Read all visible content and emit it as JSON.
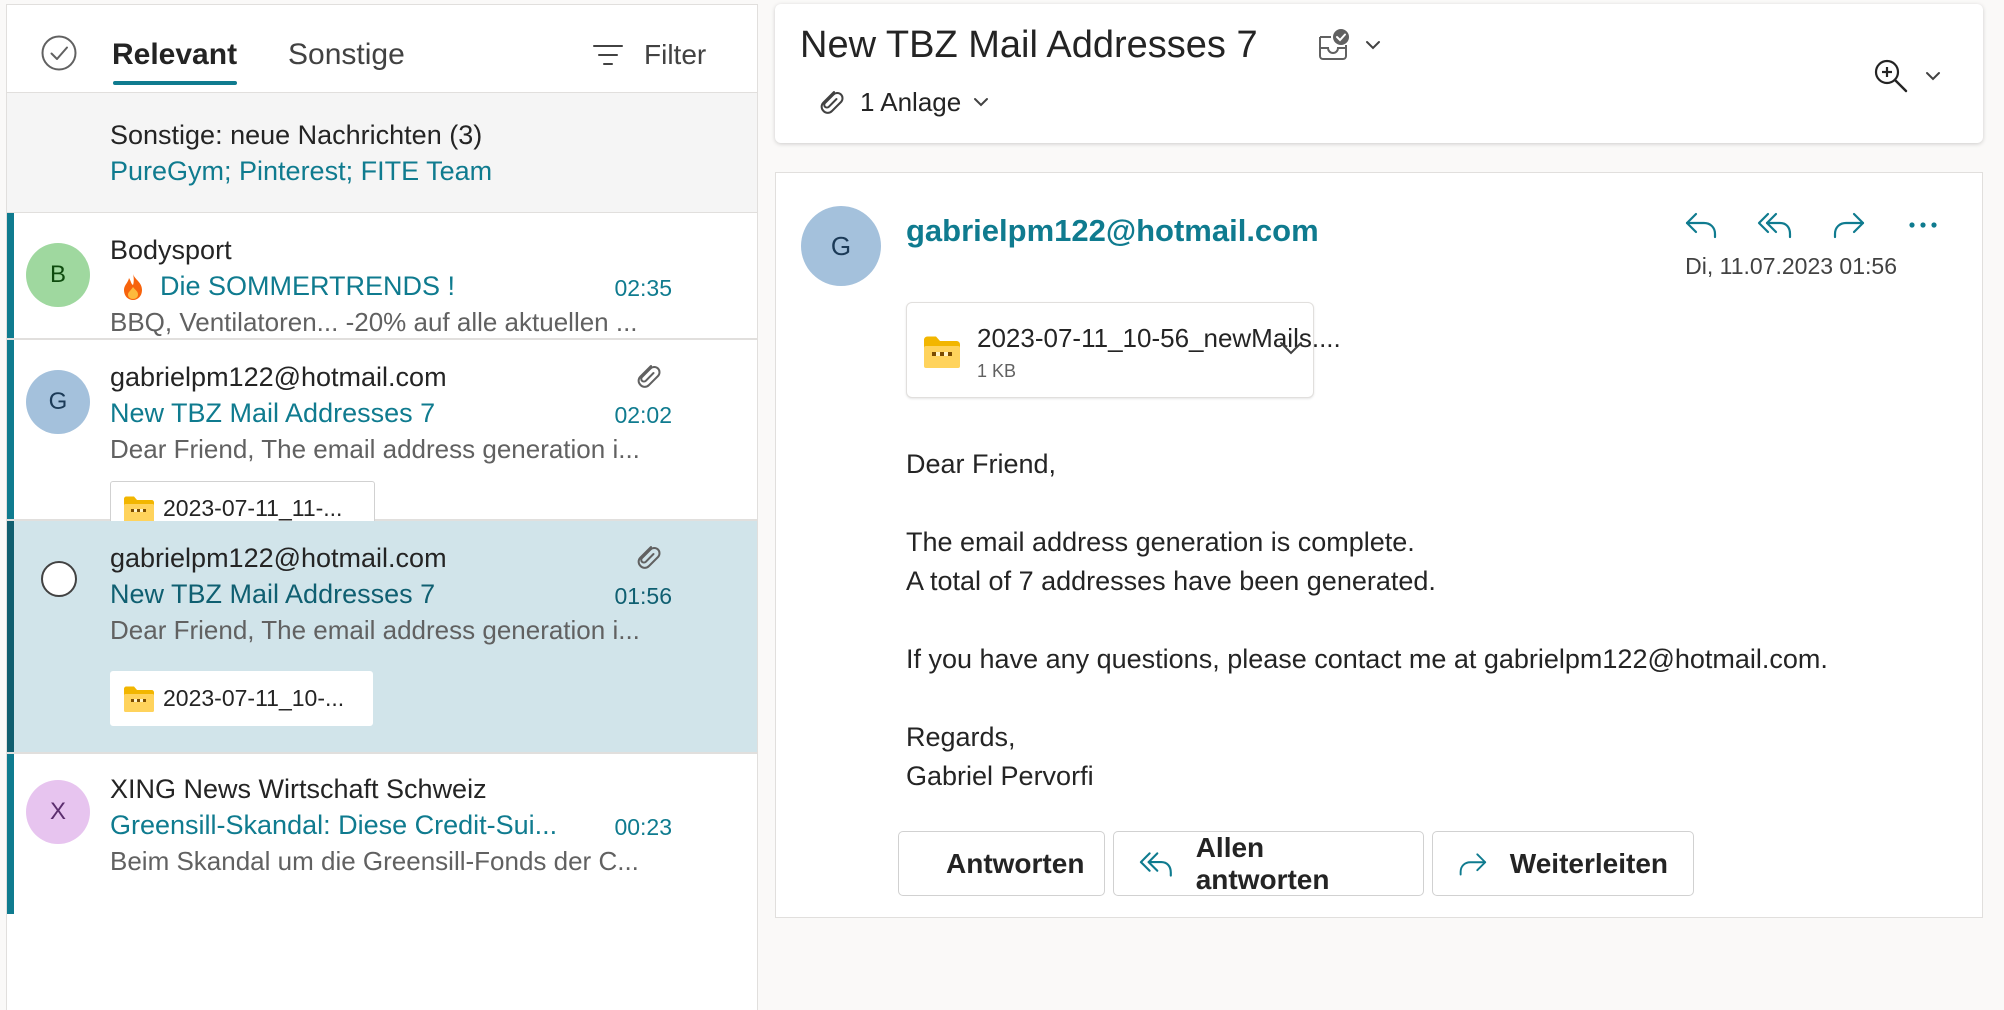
{
  "list": {
    "tabs": [
      {
        "label": "Relevant"
      },
      {
        "label": "Sonstige"
      }
    ],
    "filter_label": "Filter",
    "other_banner": {
      "title": "Sonstige: neue Nachrichten (3)",
      "senders": "PureGym; Pinterest; FITE Team"
    },
    "messages": [
      {
        "avatar": "B",
        "sender": "Bodysport",
        "subject": "Die SOMMERTRENDS !",
        "time": "02:35",
        "preview": "BBQ, Ventilatoren... -20% auf alle aktuellen ..."
      },
      {
        "avatar": "G",
        "sender": "gabrielpm122@hotmail.com",
        "subject": "New TBZ Mail Addresses 7",
        "time": "02:02",
        "preview": "Dear Friend, The email address generation i...",
        "attachment": "2023-07-11_11-..."
      },
      {
        "sender": "gabrielpm122@hotmail.com",
        "subject": "New TBZ Mail Addresses 7",
        "time": "01:56",
        "preview": "Dear Friend, The email address generation i...",
        "attachment": "2023-07-11_10-..."
      },
      {
        "avatar": "X",
        "sender": "XING News Wirtschaft Schweiz",
        "subject": "Greensill-Skandal: Diese Credit-Sui...",
        "time": "00:23",
        "preview": "Beim Skandal um die Greensill-Fonds der C..."
      }
    ]
  },
  "reading": {
    "conversation_title": "New TBZ Mail Addresses 7",
    "attachments_label": "1 Anlage",
    "avatar": "G",
    "from": "gabrielpm122@hotmail.com",
    "date": "Di, 11.07.2023 01:56",
    "file": {
      "name": "2023-07-11_10-56_newMails....",
      "size": "1 KB"
    },
    "body": [
      "Dear Friend,",
      "",
      "The email address generation is complete.",
      "A total of 7 addresses have been generated.",
      "",
      "If you have any questions, please contact me at gabrielpm122@hotmail.com.",
      "",
      "Regards,",
      "Gabriel Pervorfi"
    ],
    "buttons": {
      "reply": "Antworten",
      "reply_all": "Allen antworten",
      "forward": "Weiterleiten"
    }
  },
  "colors": {
    "accent": "#0f7b8f",
    "selected_bg": "#d1e4ea",
    "avatar_b": "#9fd89f",
    "avatar_g": "#a4c1dc",
    "avatar_x": "#e7c4ef"
  }
}
